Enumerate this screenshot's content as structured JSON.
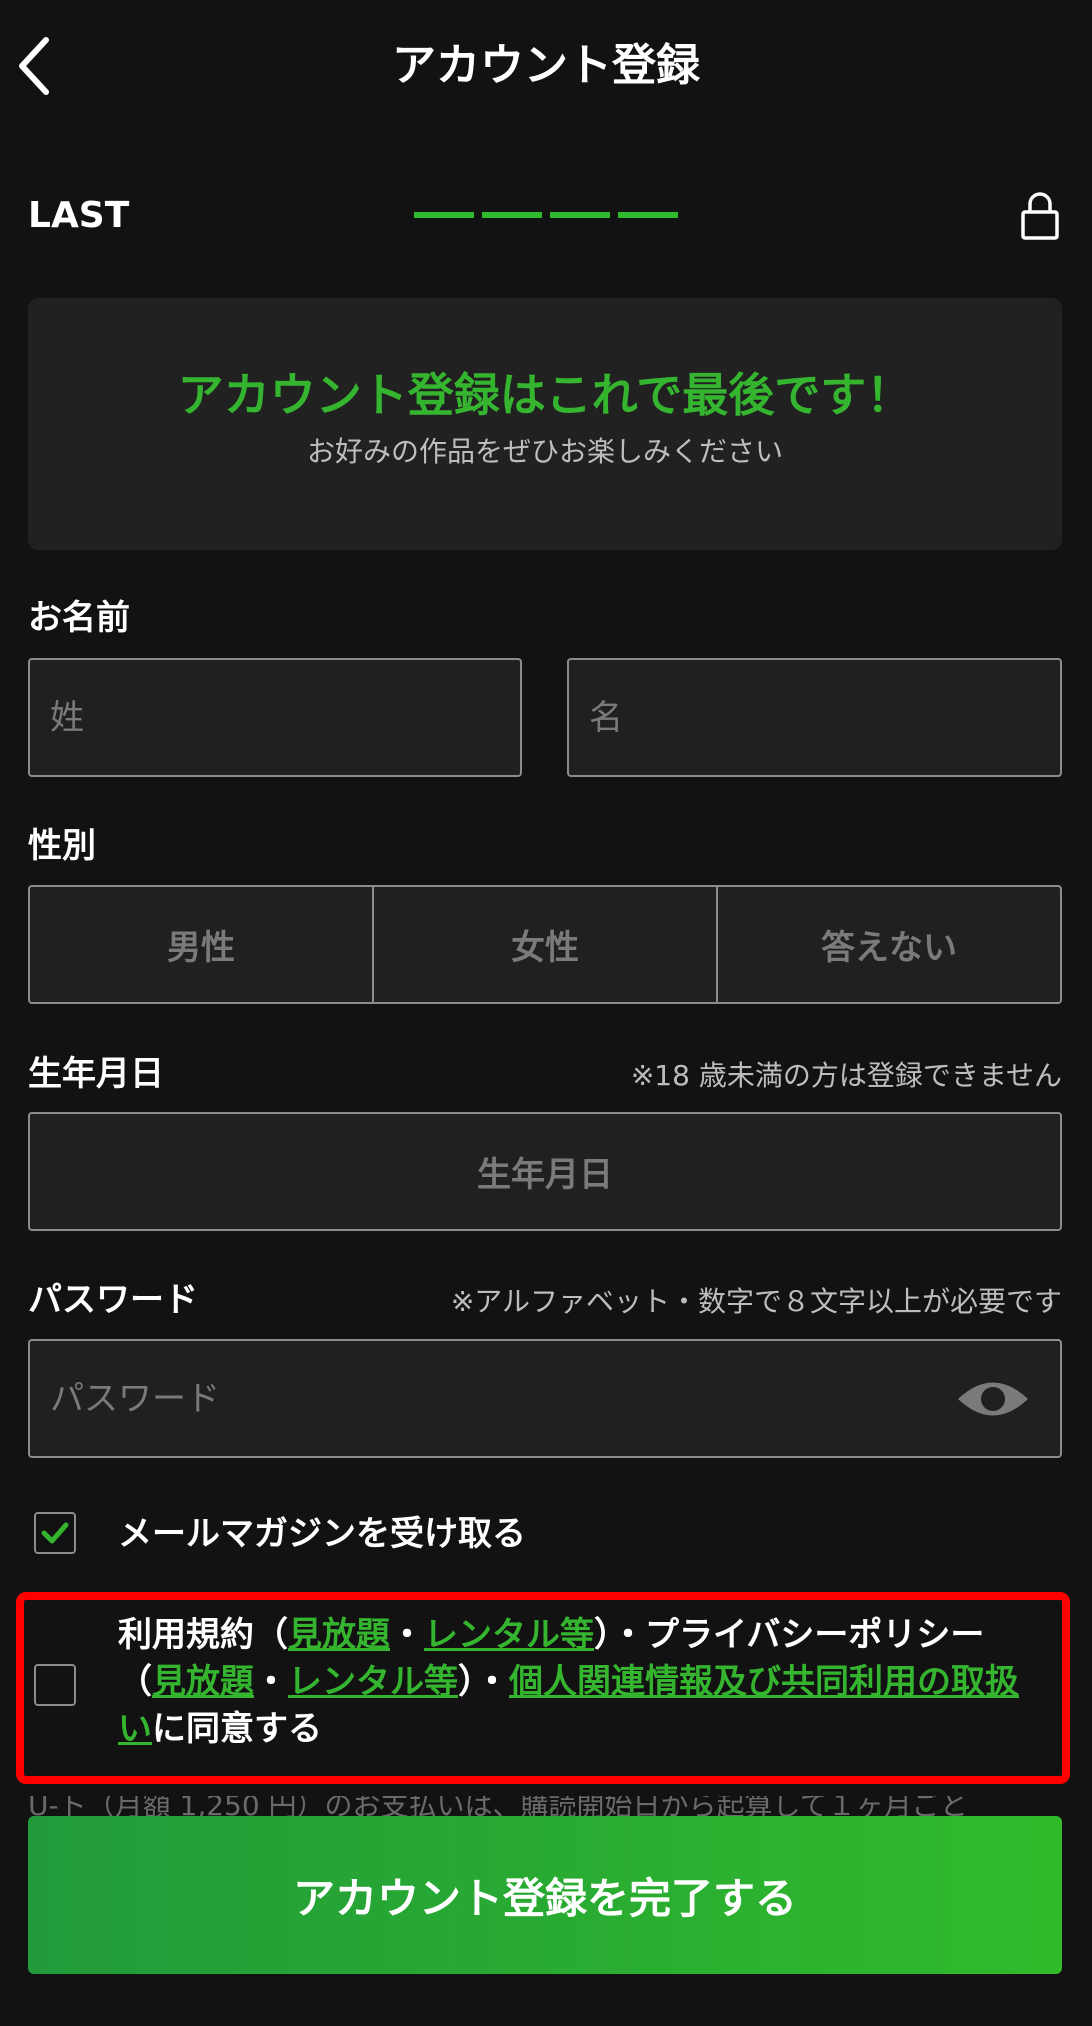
{
  "header": {
    "title": "アカウント登録"
  },
  "step": {
    "label": "LAST",
    "total": 4,
    "completed": 4
  },
  "banner": {
    "headline": "アカウント登録はこれで最後です！",
    "subtext": "お好みの作品をぜひお楽しみください"
  },
  "name": {
    "label": "お名前",
    "last_placeholder": "姓",
    "first_placeholder": "名"
  },
  "gender": {
    "label": "性別",
    "options": [
      "男性",
      "女性",
      "答えない"
    ]
  },
  "birthdate": {
    "label": "生年月日",
    "note": "※18 歳未満の方は登録できません",
    "placeholder": "生年月日"
  },
  "password": {
    "label": "パスワード",
    "note": "※アルファベット・数字で８文字以上が必要です",
    "placeholder": "パスワード"
  },
  "newsletter": {
    "label": "メールマガジンを受け取る",
    "checked": true
  },
  "terms": {
    "checked": false,
    "t1": "利用規約（",
    "l1": "見放題",
    "t2": "・",
    "l2": "レンタル等",
    "t3": "）・プライバシーポリシー（",
    "l3": "見放題",
    "t4": "・",
    "l4": "レンタル等",
    "t5": "）・",
    "l5": "個人関連情報及び共同利用の取扱い",
    "t6": "に同意する"
  },
  "partial_text": "U-ト（月額 1,250 円）のお支払いは、購読開始日から起算して１ヶ月ごと",
  "submit": {
    "label": "アカウント登録を完了する"
  },
  "colors": {
    "accent": "#35b52f",
    "background": "#111211",
    "highlight": "#ff0000"
  }
}
